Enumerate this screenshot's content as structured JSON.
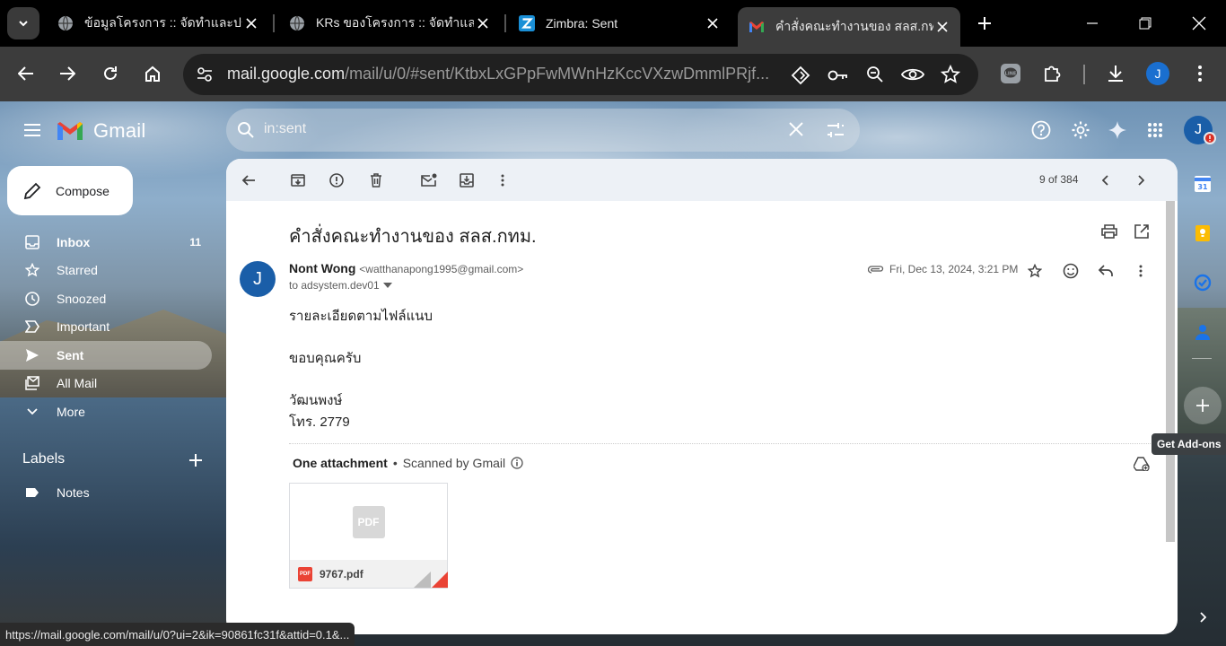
{
  "browser": {
    "tabs": [
      {
        "title": "ข้อมูลโครงการ :: จัดทำและปรับ",
        "favicon": "globe-icon",
        "active": false
      },
      {
        "title": "KRs ของโครงการ :: จัดทำและ",
        "favicon": "globe-icon",
        "active": false
      },
      {
        "title": "Zimbra: Sent",
        "favicon": "zimbra-icon",
        "active": false
      },
      {
        "title": "คำสั่งคณะทำงานของ สลส.กทม",
        "favicon": "gmail-icon",
        "active": true
      }
    ],
    "address": {
      "host": "mail.google.com",
      "path": "/mail/u/0/#sent/KtbxLxGPpFwMWnHzKccVXzwDmmlPRjf..."
    },
    "profile_initial": "J",
    "status_url": "https://mail.google.com/mail/u/0?ui=2&ik=90861fc31f&attid=0.1&..."
  },
  "gmail": {
    "logo_text": "Gmail",
    "search_query": "in:sent",
    "account_initial": "J",
    "compose_label": "Compose",
    "nav": [
      {
        "label": "Inbox",
        "count": "11",
        "icon": "inbox-icon",
        "bold": true
      },
      {
        "label": "Starred",
        "count": "",
        "icon": "star-icon"
      },
      {
        "label": "Snoozed",
        "count": "",
        "icon": "clock-icon"
      },
      {
        "label": "Important",
        "count": "",
        "icon": "important-icon"
      },
      {
        "label": "Sent",
        "count": "",
        "icon": "send-icon",
        "active": true
      },
      {
        "label": "All Mail",
        "count": "",
        "icon": "all-mail-icon"
      },
      {
        "label": "More",
        "count": "",
        "icon": "chevron-down-icon"
      }
    ],
    "labels_heading": "Labels",
    "labels": [
      {
        "label": "Notes",
        "icon": "label-icon"
      }
    ]
  },
  "message": {
    "pager": "9 of 384",
    "subject": "คำสั่งคณะทำงานของ สลส.กทม.",
    "sender_initial": "J",
    "sender_name": "Nont Wong",
    "sender_email": "<watthanapong1995@gmail.com>",
    "to": "to adsystem.dev01",
    "date": "Fri, Dec 13, 2024, 3:21 PM",
    "body": [
      "รายละเอียดตามไฟล์แนบ",
      "ขอบคุณครับ",
      "วัฒนพงษ์",
      "โทร. 2779"
    ],
    "attachment_heading": "One attachment",
    "scanned_text": "Scanned by Gmail",
    "attachment": {
      "name": "9767.pdf",
      "type_label": "PDF"
    }
  },
  "side_panel": {
    "tooltip": "Get Add-ons"
  },
  "colors": {
    "accent_blue": "#1a6fd0",
    "pdf_red": "#ea4335",
    "chrome_dark": "#3c3c3c"
  }
}
